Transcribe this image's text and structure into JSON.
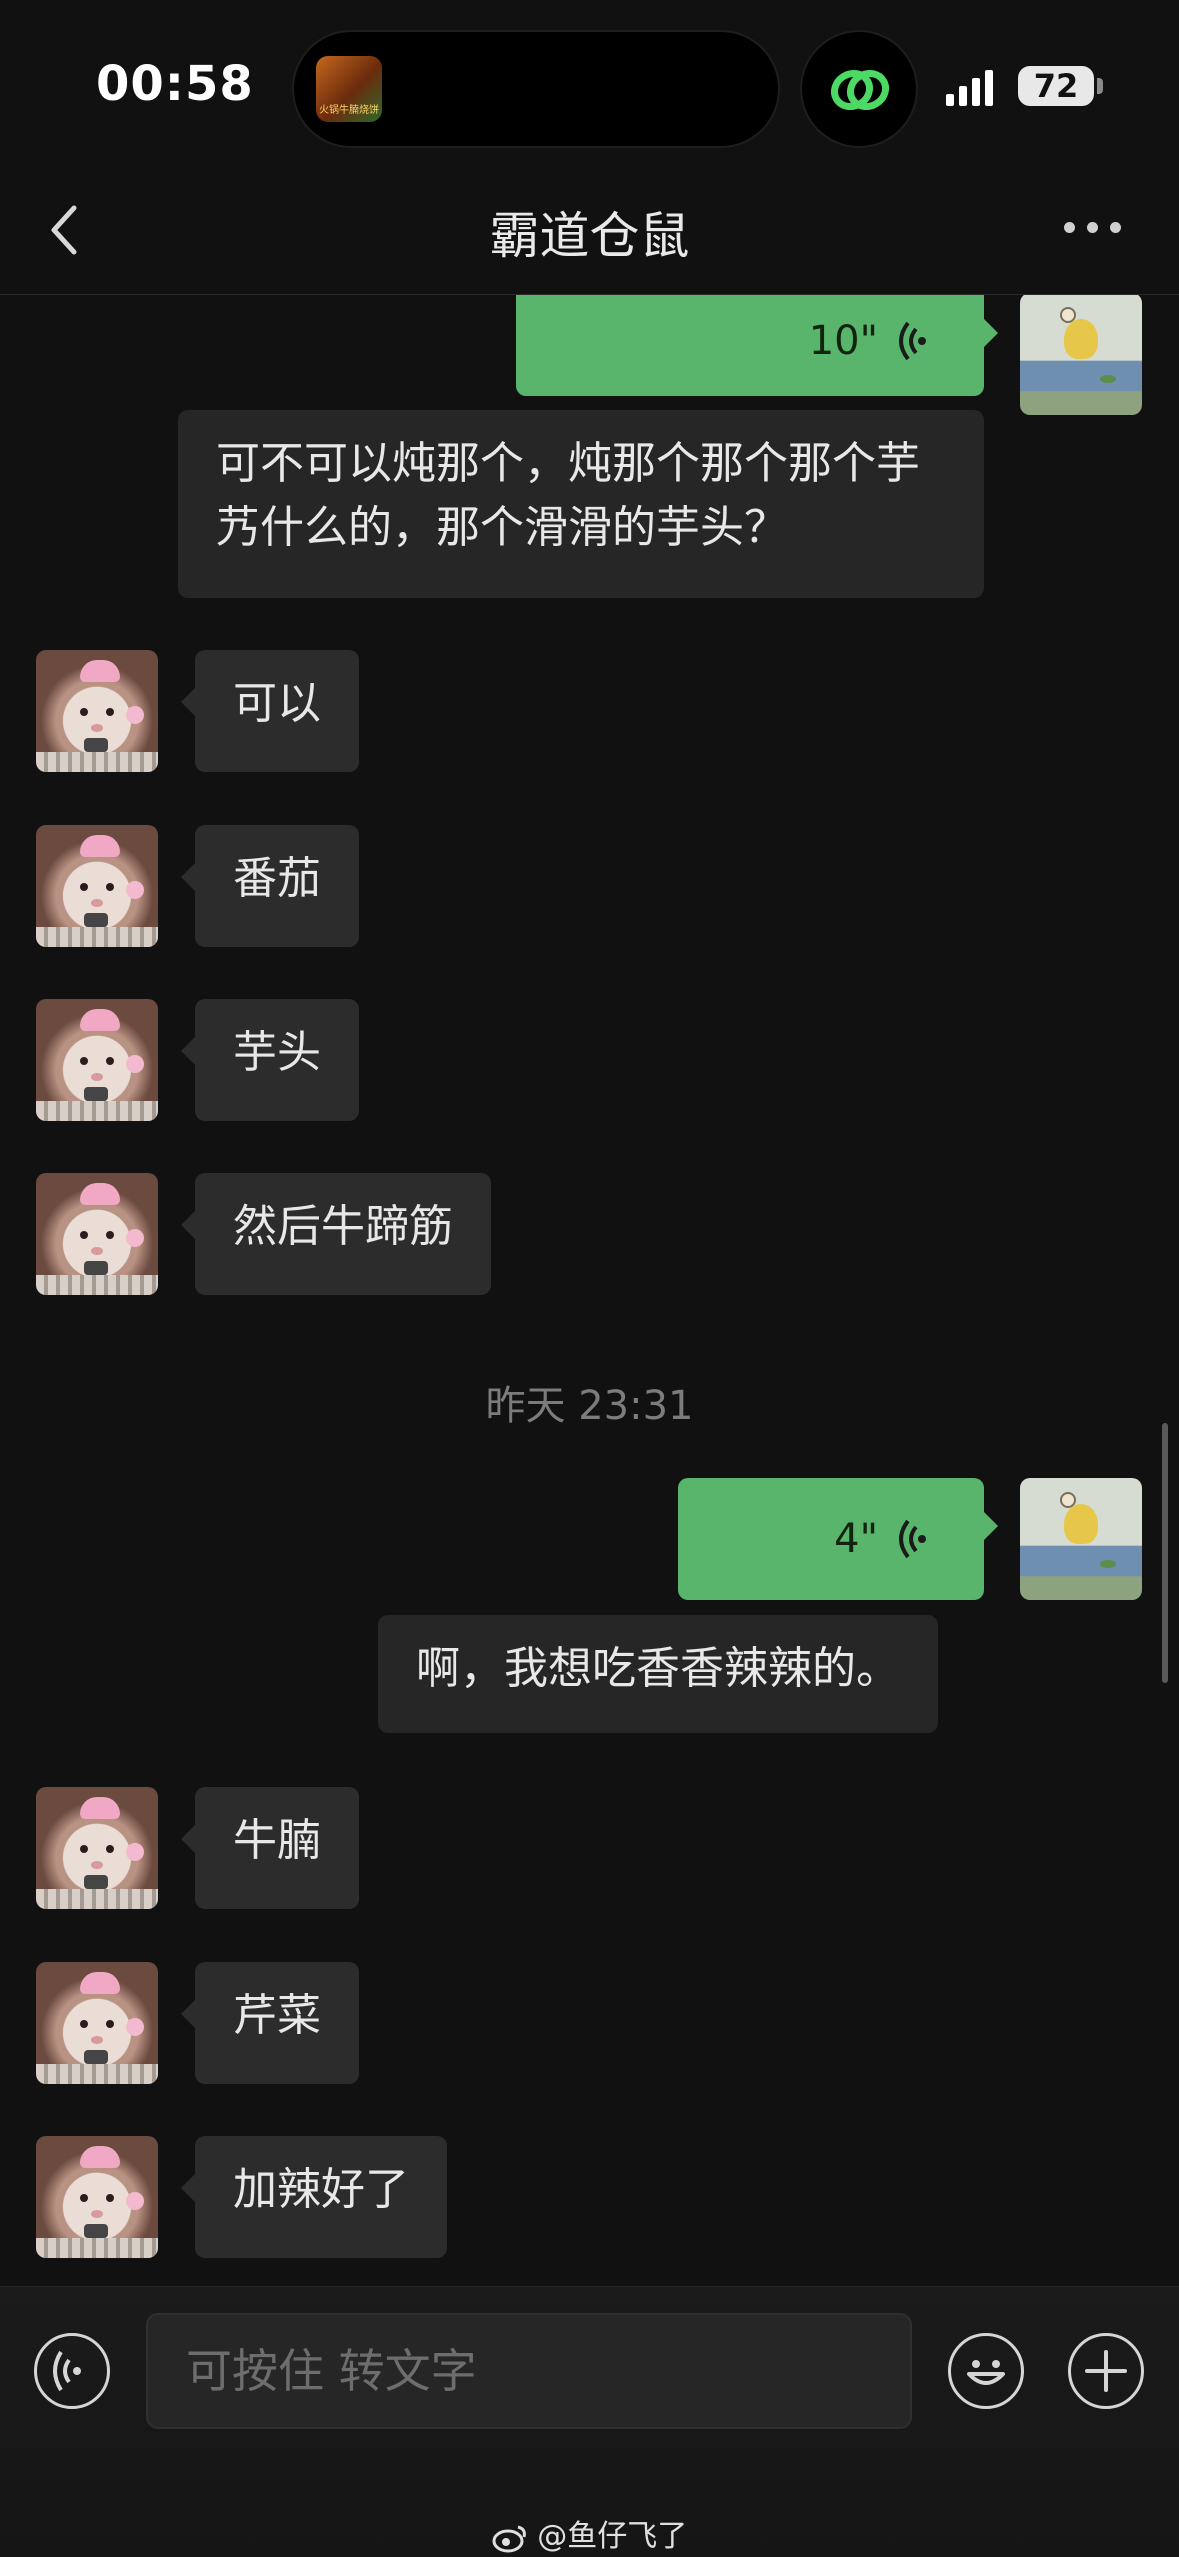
{
  "status": {
    "time": "00:58",
    "battery": "72",
    "activity_caption": "火锅牛腩烧饼"
  },
  "header": {
    "title": "霸道仓鼠"
  },
  "messages": {
    "voice1": {
      "duration": "10\""
    },
    "transcript1": "可不可以炖那个，炖那个那个那个芋艿什么的，那个滑滑的芋头？",
    "m1": "可以",
    "m2": "番茄",
    "m3": "芋头",
    "m4": "然后牛蹄筋",
    "timestamp": "昨天 23:31",
    "voice2": {
      "duration": "4\""
    },
    "transcript2": "啊，我想吃香香辣辣的。",
    "m5": "牛腩",
    "m6": "芹菜",
    "m7": "加辣好了"
  },
  "input": {
    "placeholder": "可按住 转文字"
  },
  "watermark": "@鱼仔飞了",
  "colors": {
    "outgoing": "#58b56b",
    "incoming": "#2c2c2c",
    "background": "#111111"
  },
  "icons": [
    "back-chevron-icon",
    "more-dots-icon",
    "voice-wave-icon",
    "voice-input-icon",
    "emoji-icon",
    "plus-icon",
    "weibo-icon",
    "link-icon"
  ]
}
